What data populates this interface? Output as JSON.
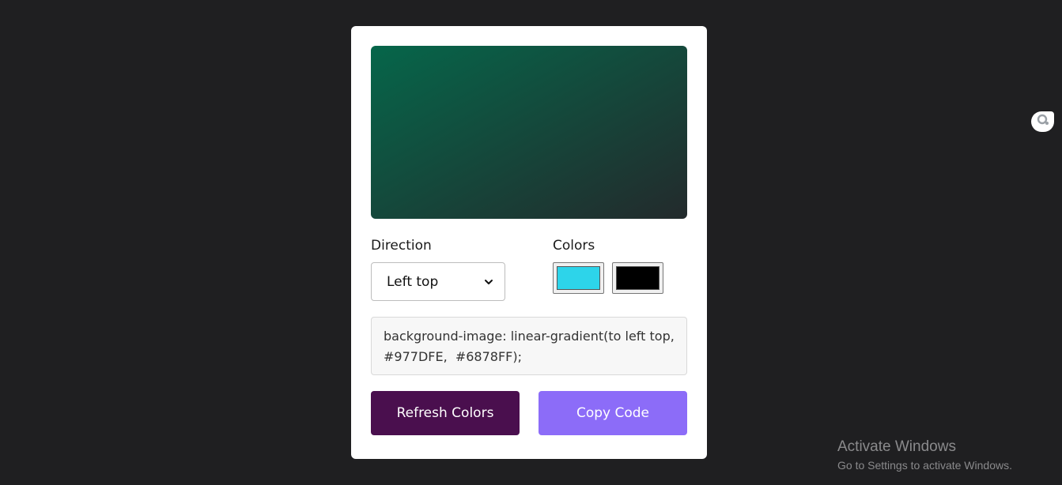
{
  "generator": {
    "direction_label": "Direction",
    "colors_label": "Colors",
    "direction_value": "Left top",
    "swatch_colors": [
      "#2dd4ea",
      "#000000"
    ],
    "code_text": "background-image: linear-gradient(to left top, #977DFE,  #6878FF);",
    "refresh_label": "Refresh Colors",
    "copy_label": "Copy Code",
    "preview_colors": [
      "#06664a",
      "#232a2c"
    ]
  },
  "page_icons": {
    "side_widget": "camera-lens-icon",
    "dropdown": "chevron-down-icon"
  },
  "windows_watermark": {
    "title": "Activate Windows",
    "subtitle": "Go to Settings to activate Windows."
  },
  "theme": {
    "page_background": "#1f1f21",
    "refresh_button_color": "#4a0f4e",
    "copy_button_color": "#8c6cf8"
  }
}
